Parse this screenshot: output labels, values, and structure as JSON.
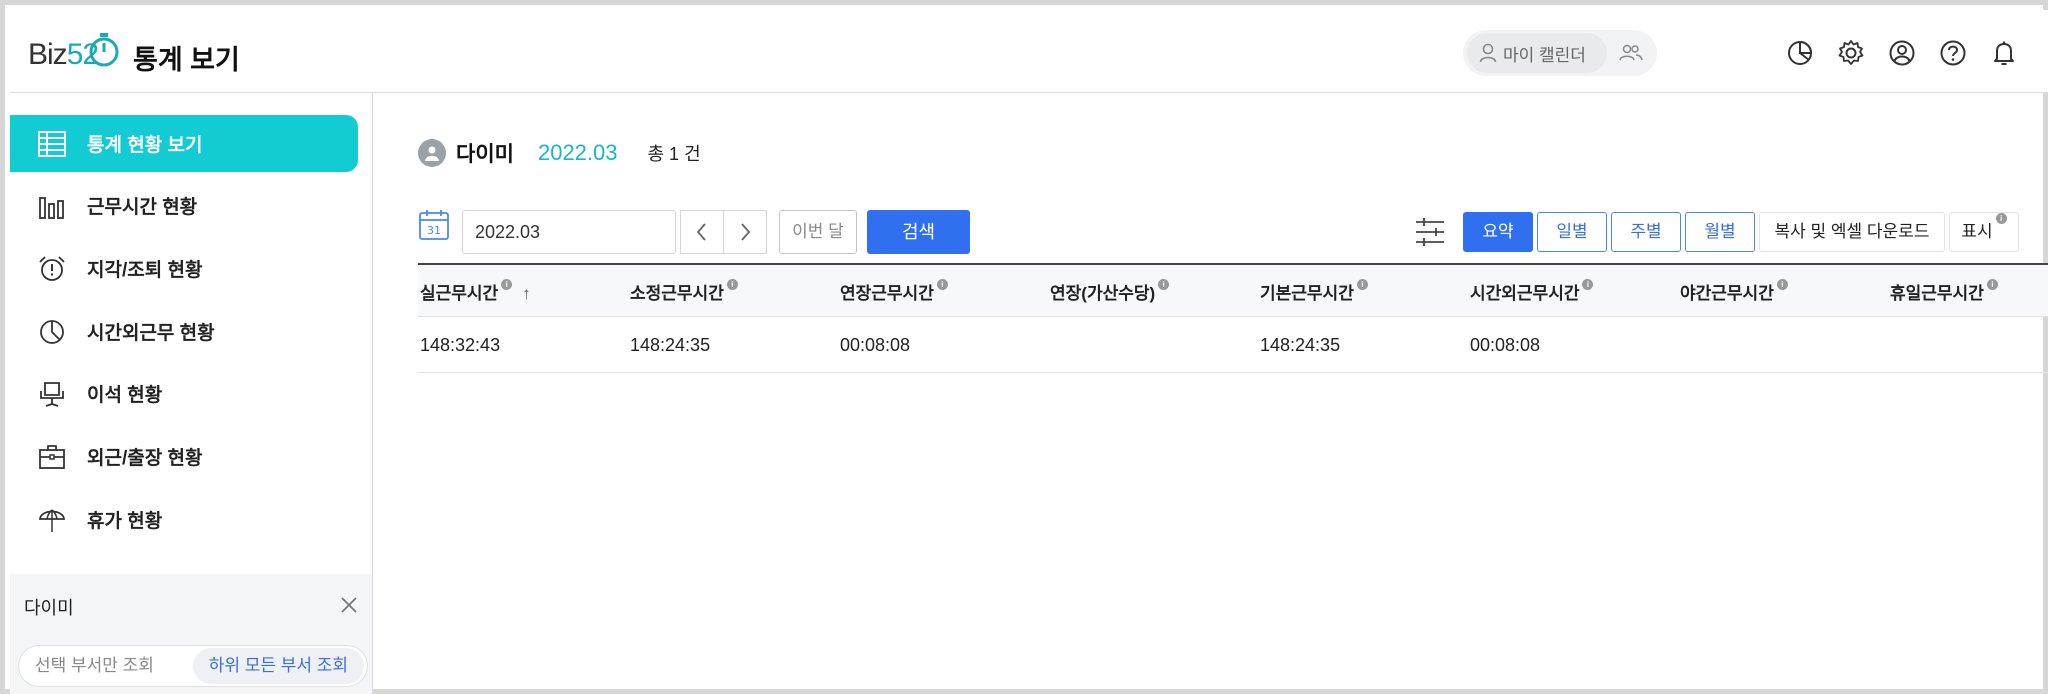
{
  "header": {
    "logo_text": "Biz",
    "logo_num": "52",
    "title": "통계 보기",
    "my_calendar": "마이 캘린더",
    "icons": [
      "pie-chart-icon",
      "gear-icon",
      "user-circle-icon",
      "help-icon",
      "bell-icon"
    ]
  },
  "sidebar": {
    "items": [
      {
        "label": "통계 현황 보기",
        "icon": "table-icon",
        "active": true
      },
      {
        "label": "근무시간 현황",
        "icon": "bar-chart-icon"
      },
      {
        "label": "지각/조퇴 현황",
        "icon": "alarm-clock-icon"
      },
      {
        "label": "시간외근무 현황",
        "icon": "pie-icon"
      },
      {
        "label": "이석 현황",
        "icon": "chair-icon"
      },
      {
        "label": "외근/출장 현황",
        "icon": "briefcase-icon"
      },
      {
        "label": "휴가 현황",
        "icon": "umbrella-icon"
      }
    ],
    "department": "다이미",
    "toggle": {
      "option1": "선택 부서만 조회",
      "option2": "하위 모든 부서 조회"
    }
  },
  "main": {
    "person_name": "다이미",
    "month": "2022.03",
    "total": "총 1 건",
    "date_value": "2022.03",
    "this_month": "이번 달",
    "search": "검색",
    "views": [
      "요약",
      "일별",
      "주별",
      "월별"
    ],
    "copy_excel": "복사 및 엑셀 다운로드",
    "display": "표시",
    "columns": [
      "실근무시간",
      "소정근무시간",
      "연장근무시간",
      "연장(가산수당)",
      "기본근무시간",
      "시간외근무시간",
      "야간근무시간",
      "휴일근무시간"
    ],
    "row": [
      "148:32:43",
      "148:24:35",
      "00:08:08",
      "",
      "148:24:35",
      "00:08:08",
      "",
      ""
    ]
  },
  "colors": {
    "accent": "#12cbd3",
    "primary": "#2f6ff0",
    "month_text": "#17b7c4"
  }
}
